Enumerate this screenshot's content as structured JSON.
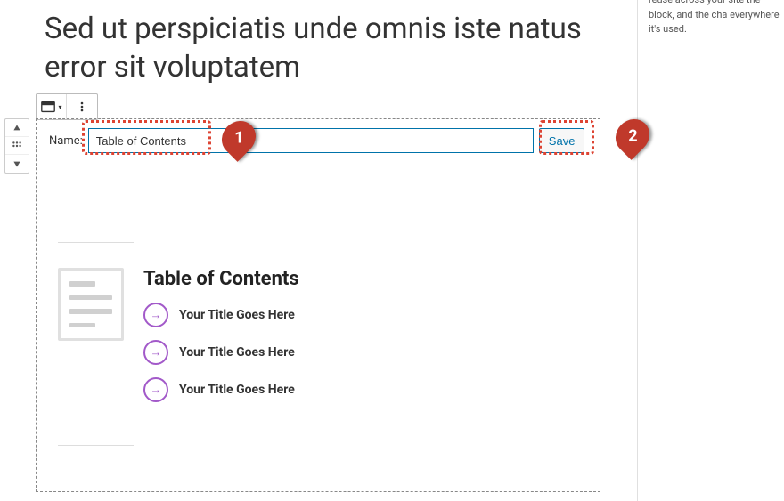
{
  "page": {
    "title": "Sed ut perspiciatis unde omnis iste natus error sit voluptatem"
  },
  "sidebar": {
    "help_text": "reuse across your site the block, and the cha everywhere it's used."
  },
  "block": {
    "name_label": "Name:",
    "name_value": "Table of Contents",
    "save_label": "Save"
  },
  "toc": {
    "heading": "Table of Contents",
    "items": [
      {
        "title": "Your Title Goes Here"
      },
      {
        "title": "Your Title Goes Here"
      },
      {
        "title": "Your Title Goes Here"
      }
    ]
  },
  "callouts": {
    "one": "1",
    "two": "2"
  }
}
